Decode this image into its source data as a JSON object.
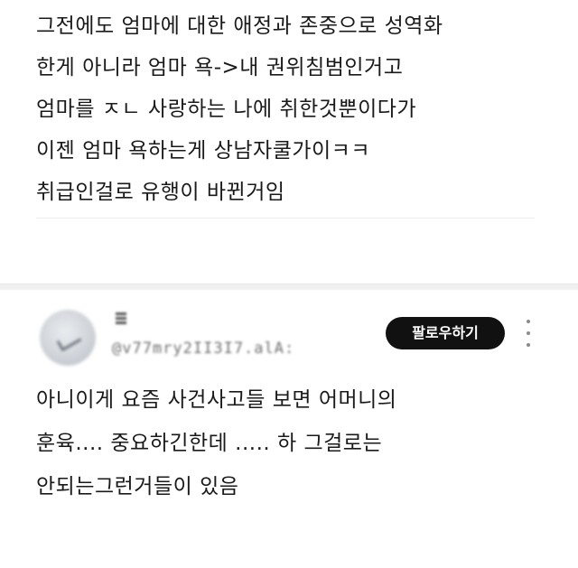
{
  "post": {
    "lines": [
      "그전에도 엄마에 대한 애정과 존중으로 성역화",
      "한게 아니라 엄마 욕->내 권위침범인거고",
      "엄마를 ㅈㄴ 사랑하는 나에 취한것뿐이다가",
      "이젠 엄마 욕하는게 상남자쿨가이ㅋㅋ",
      "취급인걸로 유행이 바뀐거임"
    ]
  },
  "reply": {
    "user": {
      "name": "ㅎ",
      "handle": "@v77mry2II3I7.alA:",
      "avatar_icon": "profile-avatar"
    },
    "follow_label": "팔로우하기",
    "more_icon": "more-vertical-icon",
    "lines": [
      "아니이게 요즘 사건사고들 보면 어머니의",
      "훈육.... 중요하긴한데 ..... 하 그걸로는",
      "안되는그런거들이 있음"
    ]
  },
  "colors": {
    "text": "#1a1a1a",
    "button_bg": "#111111",
    "button_text": "#ffffff",
    "separator": "#f1f1f1",
    "handle": "#6f6f6f"
  }
}
